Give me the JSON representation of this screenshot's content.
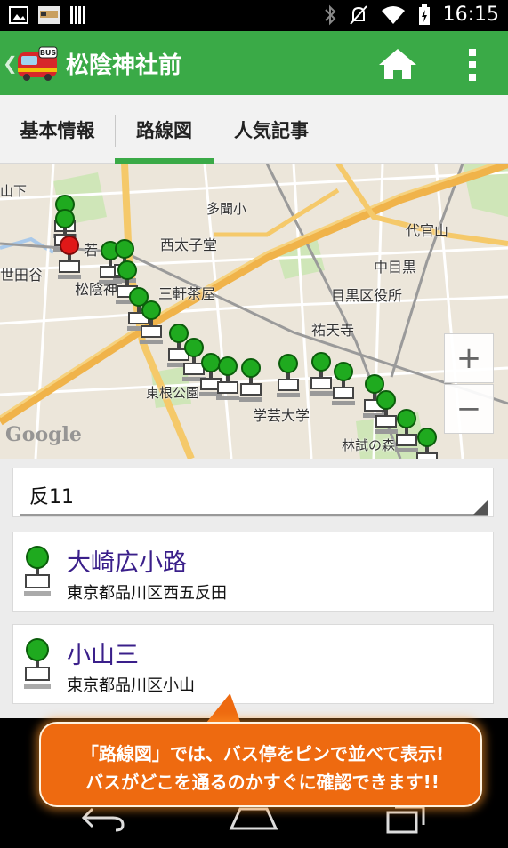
{
  "status_bar": {
    "time": "16:15",
    "icons": [
      "gallery-icon",
      "app-icon",
      "barcode-icon",
      "bluetooth-icon",
      "mute-icon",
      "wifi-icon",
      "battery-icon"
    ]
  },
  "action_bar": {
    "logo_text": "BUS",
    "title": "松陰神社前",
    "home_icon": "home-icon",
    "menu_icon": "overflow-menu-icon",
    "accent": "#3aaa47"
  },
  "tabs": [
    {
      "label": "基本情報",
      "selected": false
    },
    {
      "label": "路線図",
      "selected": true
    },
    {
      "label": "人気記事",
      "selected": false
    }
  ],
  "map": {
    "labels": {
      "yamashita": "山下",
      "setagaya": "世田谷",
      "waka": "若",
      "shoin": "松陰神",
      "tamamachi": "多聞小",
      "nishitaishido": "西太子堂",
      "sangenjaya": "三軒茶屋",
      "daikanyama": "代官山",
      "nakameguro": "中目黒",
      "meguro_office": "目黒区役所",
      "yutenji": "祐天寺",
      "higashine": "東根公園",
      "gakugei": "学芸大学",
      "rinshi": "林試の森"
    },
    "attribution": "Google",
    "zoom_in": "+",
    "zoom_out": "−"
  },
  "route_select": {
    "value": "反11"
  },
  "stops": [
    {
      "name": "大崎広小路",
      "address": "東京都品川区西五反田"
    },
    {
      "name": "小山三",
      "address": "東京都品川区小山"
    }
  ],
  "callout": {
    "line1": "「路線図」では、バス停をピンで並べて表示!",
    "line2": "バスがどこを通るのかすぐに確認できます!!"
  },
  "nav_bar": {
    "back": "back-icon",
    "home": "home-nav-icon",
    "recents": "recents-icon"
  }
}
